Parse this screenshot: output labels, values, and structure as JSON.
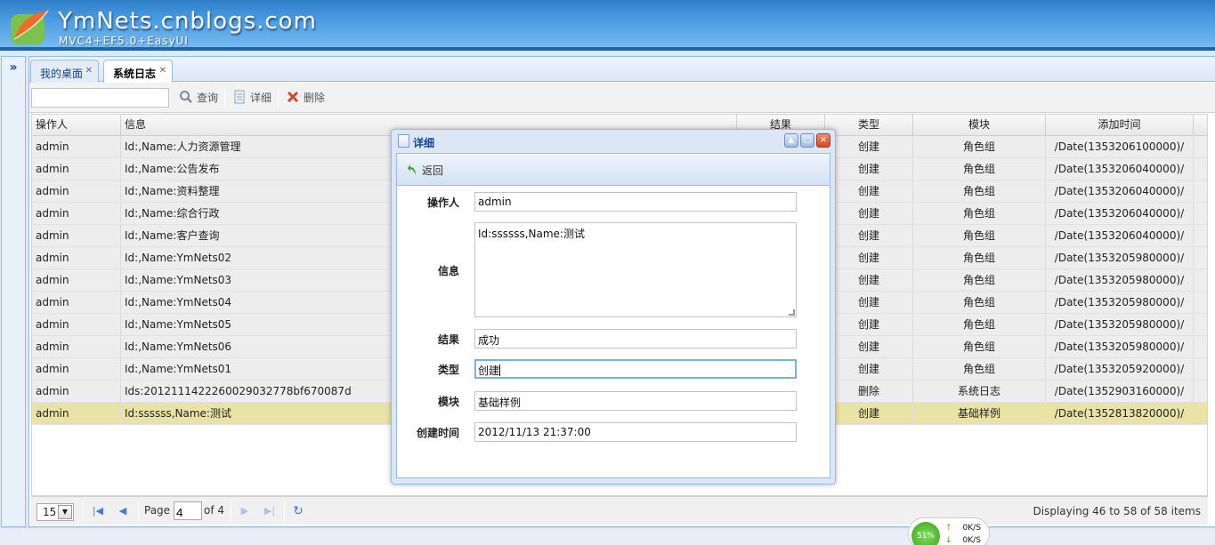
{
  "header": {
    "brand": "YmNets.cnblogs.com",
    "tagline": "MVC4+EF5.0+EasyUI"
  },
  "tabs": [
    {
      "label": "我的桌面"
    },
    {
      "label": "系统日志"
    }
  ],
  "toolbar": {
    "search_placeholder": "",
    "query_label": "查询",
    "detail_label": "详细",
    "delete_label": "删除"
  },
  "grid": {
    "columns": [
      "操作人",
      "信息",
      "结果",
      "类型",
      "模块",
      "添加时间"
    ],
    "rows": [
      {
        "user": "admin",
        "info": "Id:,Name:人力资源管理",
        "result": "",
        "type": "创建",
        "module": "角色组",
        "time": "/Date(1353206100000)/"
      },
      {
        "user": "admin",
        "info": "Id:,Name:公告发布",
        "result": "",
        "type": "创建",
        "module": "角色组",
        "time": "/Date(1353206040000)/"
      },
      {
        "user": "admin",
        "info": "Id:,Name:资料整理",
        "result": "",
        "type": "创建",
        "module": "角色组",
        "time": "/Date(1353206040000)/"
      },
      {
        "user": "admin",
        "info": "Id:,Name:综合行政",
        "result": "",
        "type": "创建",
        "module": "角色组",
        "time": "/Date(1353206040000)/"
      },
      {
        "user": "admin",
        "info": "Id:,Name:客户查询",
        "result": "",
        "type": "创建",
        "module": "角色组",
        "time": "/Date(1353206040000)/"
      },
      {
        "user": "admin",
        "info": "Id:,Name:YmNets02",
        "result": "",
        "type": "创建",
        "module": "角色组",
        "time": "/Date(1353205980000)/"
      },
      {
        "user": "admin",
        "info": "Id:,Name:YmNets03",
        "result": "",
        "type": "创建",
        "module": "角色组",
        "time": "/Date(1353205980000)/"
      },
      {
        "user": "admin",
        "info": "Id:,Name:YmNets04",
        "result": "",
        "type": "创建",
        "module": "角色组",
        "time": "/Date(1353205980000)/"
      },
      {
        "user": "admin",
        "info": "Id:,Name:YmNets05",
        "result": "",
        "type": "创建",
        "module": "角色组",
        "time": "/Date(1353205980000)/"
      },
      {
        "user": "admin",
        "info": "Id:,Name:YmNets06",
        "result": "",
        "type": "创建",
        "module": "角色组",
        "time": "/Date(1353205980000)/"
      },
      {
        "user": "admin",
        "info": "Id:,Name:YmNets01",
        "result": "",
        "type": "创建",
        "module": "角色组",
        "time": "/Date(1353205920000)/"
      },
      {
        "user": "admin",
        "info": "Ids:2012111422260029032778bf670087d",
        "result": "",
        "type": "删除",
        "module": "系统日志",
        "time": "/Date(1352903160000)/"
      },
      {
        "user": "admin",
        "info": "Id:ssssss,Name:测试",
        "result": "",
        "type": "创建",
        "module": "基础样例",
        "time": "/Date(1352813820000)/",
        "selected": true
      }
    ]
  },
  "pager": {
    "page_size": "15",
    "page_label": "Page",
    "page_value": "4",
    "of_label": "of 4",
    "info": "Displaying 46 to 58 of 58 items"
  },
  "dialog": {
    "title": "详细",
    "back_label": "返回",
    "fields": {
      "user_label": "操作人",
      "user_value": "admin",
      "info_label": "信息",
      "info_value": "Id:ssssss,Name:测试",
      "result_label": "结果",
      "result_value": "成功",
      "type_label": "类型",
      "type_value": "创建",
      "module_label": "模块",
      "module_value": "基础样例",
      "time_label": "创建时间",
      "time_value": "2012/11/13 21:37:00"
    }
  },
  "network": {
    "percent": "51%",
    "up": "0K/S",
    "down": "0K/S"
  }
}
